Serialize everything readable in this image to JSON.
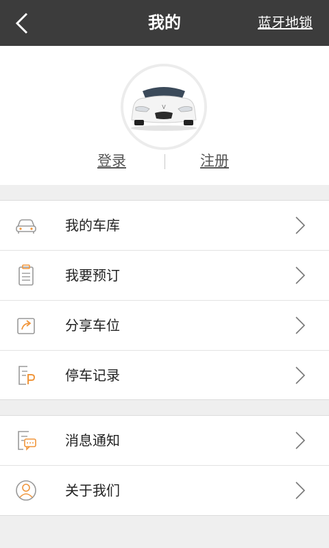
{
  "header": {
    "title": "我的",
    "right_link": "蓝牙地锁"
  },
  "profile": {
    "login_label": "登录",
    "register_label": "注册"
  },
  "menu_group_1": [
    {
      "label": "我的车库",
      "icon": "car-icon"
    },
    {
      "label": "我要预订",
      "icon": "clipboard-icon"
    },
    {
      "label": "分享车位",
      "icon": "share-icon"
    },
    {
      "label": "停车记录",
      "icon": "parking-record-icon"
    }
  ],
  "menu_group_2": [
    {
      "label": "消息通知",
      "icon": "message-icon"
    },
    {
      "label": "关于我们",
      "icon": "user-circle-icon"
    }
  ],
  "colors": {
    "topbar": "#3c3c3c",
    "accent": "#f0963c",
    "icon_gray": "#999999"
  }
}
